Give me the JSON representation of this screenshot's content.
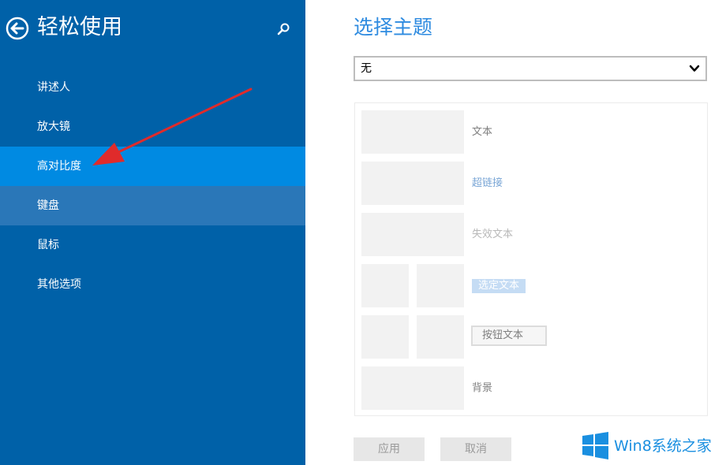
{
  "sidebar": {
    "title": "轻松使用",
    "back_icon": "back-arrow-circle-icon",
    "search_icon": "search-icon",
    "items": [
      {
        "label": "讲述人"
      },
      {
        "label": "放大镜"
      },
      {
        "label": "高对比度",
        "state": "selected"
      },
      {
        "label": "键盘",
        "state": "hover"
      },
      {
        "label": "鼠标"
      },
      {
        "label": "其他选项"
      }
    ],
    "colors": {
      "background": "#0061a8",
      "selected": "#008ae2",
      "hover": "#2a77b8"
    }
  },
  "main": {
    "title": "选择主题",
    "theme_select": {
      "value": "无",
      "icon": "chevron-down-icon"
    },
    "preview": {
      "text": "文本",
      "hyperlink": "超链接",
      "disabled_text": "失效文本",
      "selected_text": "选定文本",
      "button_text": "按钮文本",
      "background": "背景"
    },
    "apply_label": "应用",
    "cancel_label": "取消",
    "accent_color": "#2e8be0"
  },
  "annotation": {
    "icon": "red-arrow-pointer",
    "color": "#e02b2b"
  },
  "watermark": {
    "text": "Win8系统之家",
    "logo_icon": "windows-logo-icon"
  }
}
